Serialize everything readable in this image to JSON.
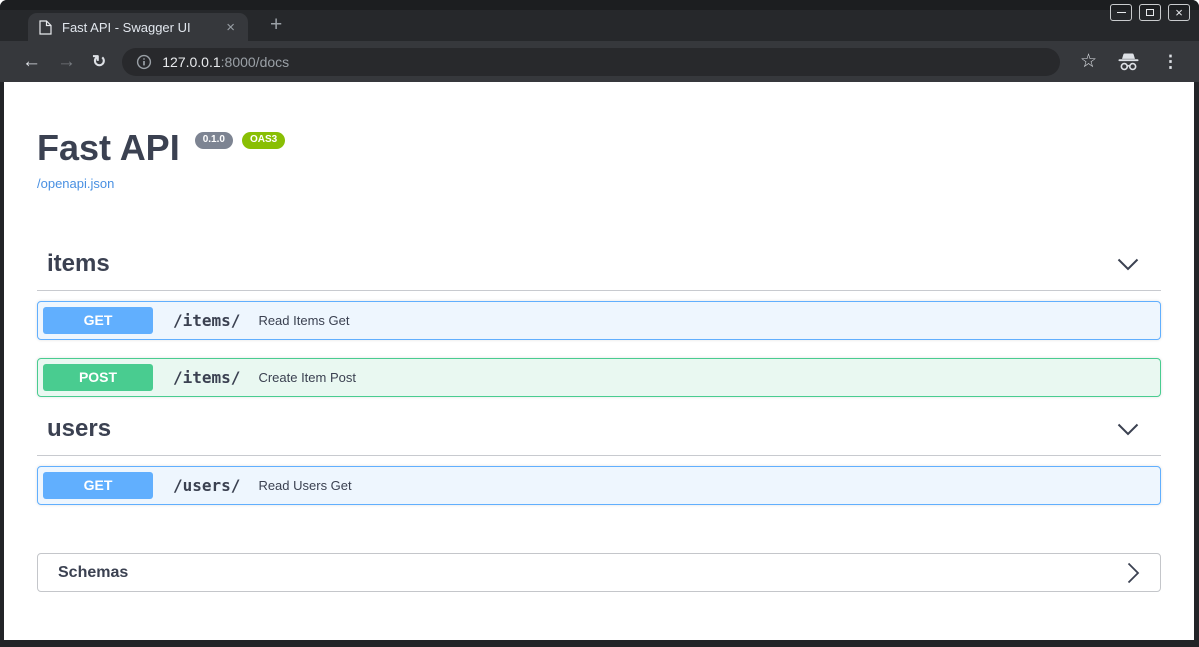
{
  "browser": {
    "tab": {
      "title": "Fast API - Swagger UI",
      "close_icon": "×"
    },
    "new_tab_icon": "+",
    "toolbar": {
      "back_icon": "←",
      "forward_icon": "→",
      "refresh_icon": "↻",
      "star_icon": "☆",
      "menu_icon": "⋮",
      "url": {
        "host": "127.0.0.1",
        "rest": ":8000/docs"
      }
    },
    "window_close_icon": "×"
  },
  "api": {
    "title": "Fast API",
    "version": "0.1.0",
    "spec_badge": "OAS3",
    "spec_link": "/openapi.json",
    "sections": [
      {
        "name": "items",
        "operations": [
          {
            "method": "GET",
            "path": "/items/",
            "summary": "Read Items Get"
          },
          {
            "method": "POST",
            "path": "/items/",
            "summary": "Create Item Post"
          }
        ]
      },
      {
        "name": "users",
        "operations": [
          {
            "method": "GET",
            "path": "/users/",
            "summary": "Read Users Get"
          }
        ]
      }
    ],
    "schemas_label": "Schemas"
  },
  "colors": {
    "get_accent": "#61affe",
    "post_accent": "#49cc90",
    "version_badge": "#7d8492",
    "oas_badge": "#89bf04",
    "link": "#4990e2",
    "text": "#3b4151"
  }
}
